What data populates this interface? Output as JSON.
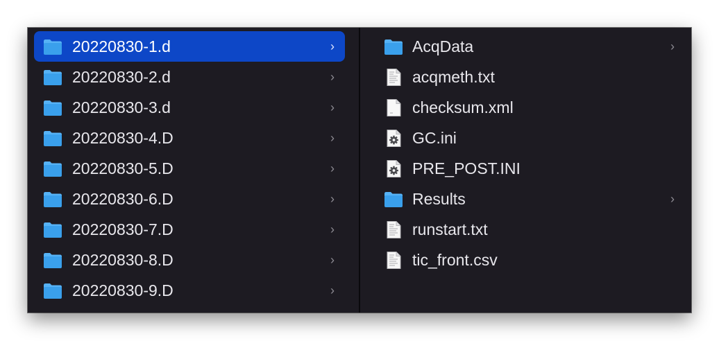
{
  "left_column": {
    "items": [
      {
        "name": "20220830-1.d",
        "type": "folder",
        "selected": true
      },
      {
        "name": "20220830-2.d",
        "type": "folder"
      },
      {
        "name": "20220830-3.d",
        "type": "folder"
      },
      {
        "name": "20220830-4.D",
        "type": "folder"
      },
      {
        "name": "20220830-5.D",
        "type": "folder"
      },
      {
        "name": "20220830-6.D",
        "type": "folder"
      },
      {
        "name": "20220830-7.D",
        "type": "folder"
      },
      {
        "name": "20220830-8.D",
        "type": "folder"
      },
      {
        "name": "20220830-9.D",
        "type": "folder"
      }
    ]
  },
  "right_column": {
    "items": [
      {
        "name": "AcqData",
        "type": "folder"
      },
      {
        "name": "acqmeth.txt",
        "type": "text-file"
      },
      {
        "name": "checksum.xml",
        "type": "document-file"
      },
      {
        "name": "GC.ini",
        "type": "settings-file"
      },
      {
        "name": "PRE_POST.INI",
        "type": "settings-file"
      },
      {
        "name": "Results",
        "type": "folder"
      },
      {
        "name": "runstart.txt",
        "type": "text-file"
      },
      {
        "name": "tic_front.csv",
        "type": "text-file"
      }
    ]
  },
  "chevron_glyph": "›",
  "colors": {
    "window_bg": "#1d1b22",
    "selection": "#0d47c7",
    "folder_blue": "#3aa0ec",
    "text": "#e8e7ec"
  }
}
